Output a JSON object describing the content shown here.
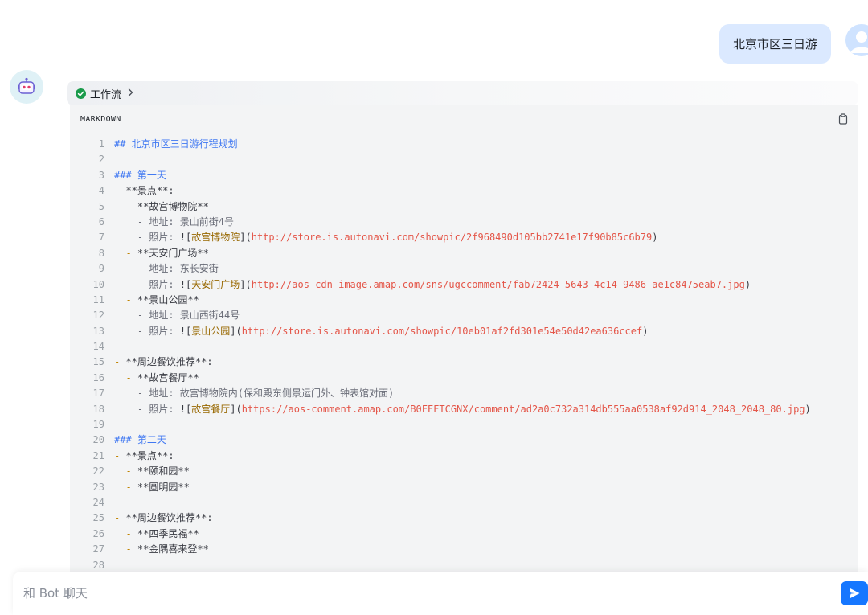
{
  "user_message": "北京市区三日游",
  "workflow": {
    "label": "工作流",
    "status_color": "#1a9b4b"
  },
  "code_block": {
    "language": "MARKDOWN",
    "lines": [
      [
        {
          "t": "## 北京市区三日游行程规划",
          "c": "c-head"
        }
      ],
      [],
      [
        {
          "t": "### 第一天",
          "c": "c-head"
        }
      ],
      [
        {
          "t": "- ",
          "c": "c-bul"
        },
        {
          "t": "**景点**:",
          "c": "c-txt"
        }
      ],
      [
        {
          "t": "  - ",
          "c": "c-bul"
        },
        {
          "t": "**故宫博物院**",
          "c": "c-txt"
        }
      ],
      [
        {
          "t": "    - 地址: 景山前街4号",
          "c": "c-sub"
        }
      ],
      [
        {
          "t": "    - 照片: ",
          "c": "c-sub"
        },
        {
          "t": "![",
          "c": "c-pun"
        },
        {
          "t": "故宫博物院",
          "c": "c-link"
        },
        {
          "t": "](",
          "c": "c-pun"
        },
        {
          "t": "http://store.is.autonavi.com/showpic/2f968490d105bb2741e17f90b85c6b79",
          "c": "c-url"
        },
        {
          "t": ")",
          "c": "c-pun"
        }
      ],
      [
        {
          "t": "  - ",
          "c": "c-bul"
        },
        {
          "t": "**天安门广场**",
          "c": "c-txt"
        }
      ],
      [
        {
          "t": "    - 地址: 东长安街",
          "c": "c-sub"
        }
      ],
      [
        {
          "t": "    - 照片: ",
          "c": "c-sub"
        },
        {
          "t": "![",
          "c": "c-pun"
        },
        {
          "t": "天安门广场",
          "c": "c-link"
        },
        {
          "t": "](",
          "c": "c-pun"
        },
        {
          "t": "http://aos-cdn-image.amap.com/sns/ugccomment/fab72424-5643-4c14-9486-ae1c8475eab7.jpg",
          "c": "c-url"
        },
        {
          "t": ")",
          "c": "c-pun"
        }
      ],
      [
        {
          "t": "  - ",
          "c": "c-bul"
        },
        {
          "t": "**景山公园**",
          "c": "c-txt"
        }
      ],
      [
        {
          "t": "    - 地址: 景山西街44号",
          "c": "c-sub"
        }
      ],
      [
        {
          "t": "    - 照片: ",
          "c": "c-sub"
        },
        {
          "t": "![",
          "c": "c-pun"
        },
        {
          "t": "景山公园",
          "c": "c-link"
        },
        {
          "t": "](",
          "c": "c-pun"
        },
        {
          "t": "http://store.is.autonavi.com/showpic/10eb01af2fd301e54e50d42ea636ccef",
          "c": "c-url"
        },
        {
          "t": ")",
          "c": "c-pun"
        }
      ],
      [],
      [
        {
          "t": "- ",
          "c": "c-bul"
        },
        {
          "t": "**周边餐饮推荐**:",
          "c": "c-txt"
        }
      ],
      [
        {
          "t": "  - ",
          "c": "c-bul"
        },
        {
          "t": "**故宫餐厅**",
          "c": "c-txt"
        }
      ],
      [
        {
          "t": "    - 地址: 故宫博物院内(保和殿东侧景运门外、钟表馆对面)",
          "c": "c-sub"
        }
      ],
      [
        {
          "t": "    - 照片: ",
          "c": "c-sub"
        },
        {
          "t": "![",
          "c": "c-pun"
        },
        {
          "t": "故宫餐厅",
          "c": "c-link"
        },
        {
          "t": "](",
          "c": "c-pun"
        },
        {
          "t": "https://aos-comment.amap.com/B0FFFTCGNX/comment/ad2a0c732a314db555aa0538af92d914_2048_2048_80.jpg",
          "c": "c-url"
        },
        {
          "t": ")",
          "c": "c-pun"
        }
      ],
      [],
      [
        {
          "t": "### 第二天",
          "c": "c-head"
        }
      ],
      [
        {
          "t": "- ",
          "c": "c-bul"
        },
        {
          "t": "**景点**:",
          "c": "c-txt"
        }
      ],
      [
        {
          "t": "  - ",
          "c": "c-bul"
        },
        {
          "t": "**颐和园**",
          "c": "c-txt"
        }
      ],
      [
        {
          "t": "  - ",
          "c": "c-bul"
        },
        {
          "t": "**圆明园**",
          "c": "c-txt"
        }
      ],
      [],
      [
        {
          "t": "- ",
          "c": "c-bul"
        },
        {
          "t": "**周边餐饮推荐**:",
          "c": "c-txt"
        }
      ],
      [
        {
          "t": "  - ",
          "c": "c-bul"
        },
        {
          "t": "**四季民福**",
          "c": "c-txt"
        }
      ],
      [
        {
          "t": "  - ",
          "c": "c-bul"
        },
        {
          "t": "**金隅喜来登**",
          "c": "c-txt"
        }
      ],
      []
    ]
  },
  "composer": {
    "placeholder": "和 Bot 聊天"
  },
  "icons": {
    "bot_avatar": "robot-icon",
    "user_avatar": "user-icon",
    "workflow_status": "check-circle-icon",
    "copy": "clipboard-icon",
    "send": "send-icon"
  },
  "colors": {
    "accent": "#1677ff",
    "user_bubble": "#dbe9ff",
    "code_bg": "#f3f4f5"
  }
}
